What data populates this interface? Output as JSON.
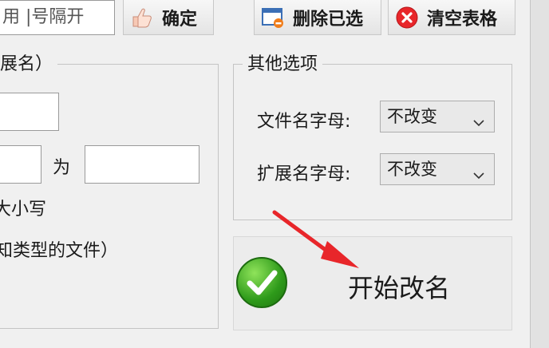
{
  "toolbar": {
    "separator_input_value": "用 |号隔开",
    "confirm_label": "确定",
    "delete_selected_label": "删除已选",
    "clear_table_label": "清空表格"
  },
  "left_panel": {
    "legend": "展名）",
    "replace_word": "为",
    "case_text": "大小写",
    "unknown_type_text": "知类型的文件）"
  },
  "other_options": {
    "legend": "其他选项",
    "filename_case_label": "文件名字母:",
    "filename_case_value": "不改变",
    "ext_case_label": "扩展名字母:",
    "ext_case_value": "不改变"
  },
  "start": {
    "label": "开始改名"
  },
  "colors": {
    "accent_red": "#e8262a",
    "start_green": "#2e9a1a"
  }
}
